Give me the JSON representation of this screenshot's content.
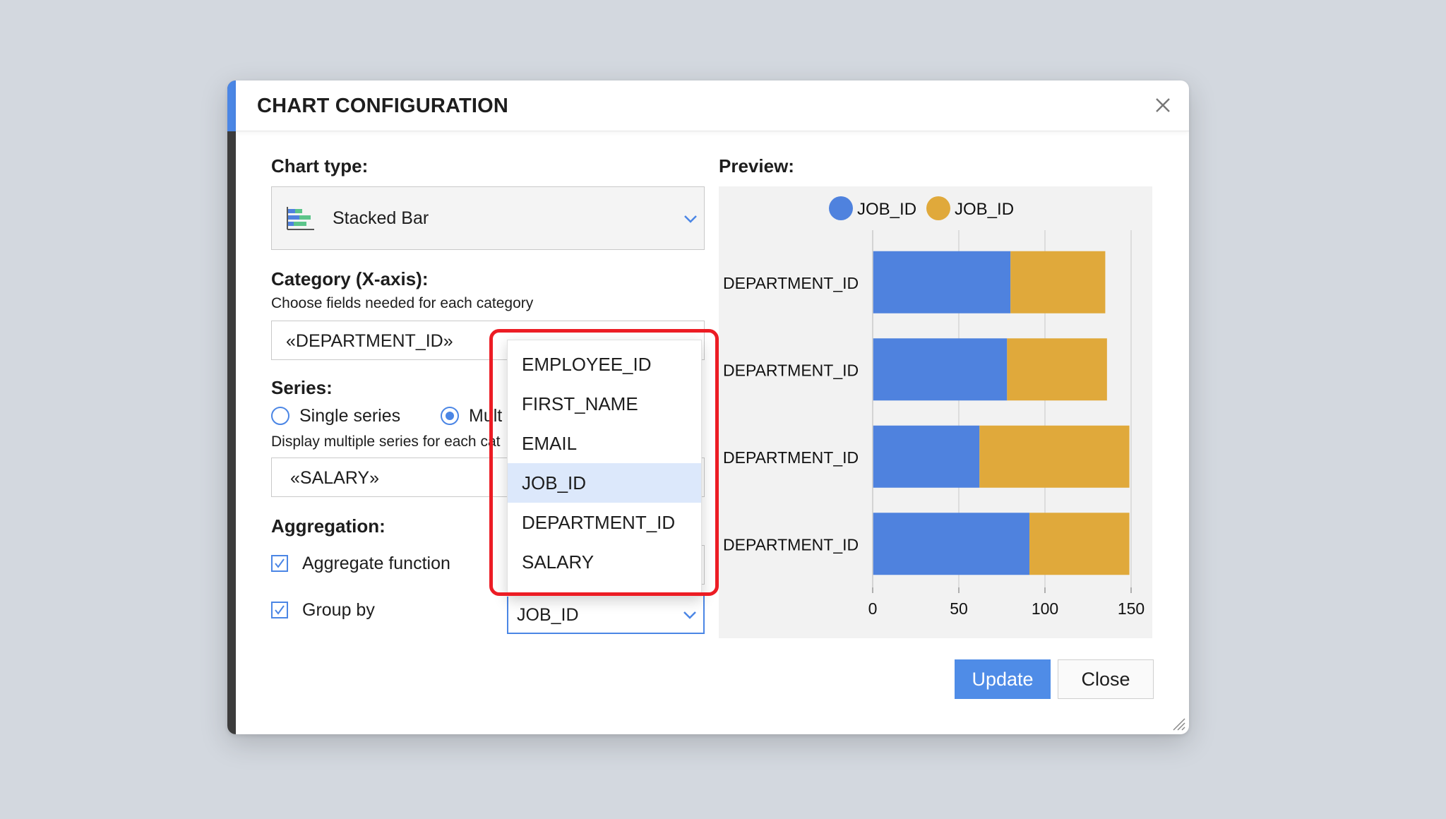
{
  "dialog": {
    "title": "CHART CONFIGURATION",
    "close_icon": "close-icon"
  },
  "chart_type": {
    "label": "Chart type:",
    "value": "Stacked Bar",
    "icon": "stacked-bar-chart-icon"
  },
  "category": {
    "label": "Category (X-axis):",
    "help": "Choose fields needed for each category",
    "value": "«DEPARTMENT_ID»"
  },
  "series": {
    "label": "Series:",
    "single_label": "Single series",
    "multi_label": "Mult",
    "selected": "multi",
    "help": "Display multiple series for each cat",
    "value": "«SALARY»"
  },
  "aggregation": {
    "label": "Aggregation:",
    "aggregate_label": "Aggregate function",
    "aggregate_checked": true,
    "groupby_label": "Group by",
    "groupby_checked": true,
    "groupby_value": "JOB_ID"
  },
  "dropdown": {
    "options": [
      "EMPLOYEE_ID",
      "FIRST_NAME",
      "EMAIL",
      "JOB_ID",
      "DEPARTMENT_ID",
      "SALARY"
    ],
    "selected": "JOB_ID"
  },
  "preview": {
    "label": "Preview:"
  },
  "chart_data": {
    "type": "bar",
    "orientation": "horizontal",
    "stacked": true,
    "categories": [
      "DEPARTMENT_ID",
      "DEPARTMENT_ID",
      "DEPARTMENT_ID",
      "DEPARTMENT_ID"
    ],
    "series": [
      {
        "name": "JOB_ID",
        "color": "#4f82de",
        "values": [
          80,
          78,
          62,
          91
        ]
      },
      {
        "name": "JOB_ID",
        "color": "#e0a93b",
        "values": [
          55,
          58,
          87,
          58
        ]
      }
    ],
    "xlim": [
      0,
      150
    ],
    "xticks": [
      0,
      50,
      100,
      150
    ],
    "grid": true,
    "legend": "top"
  },
  "buttons": {
    "update": "Update",
    "close": "Close"
  },
  "colors": {
    "accent": "#4b86e5",
    "highlight": "#ec1c24"
  }
}
